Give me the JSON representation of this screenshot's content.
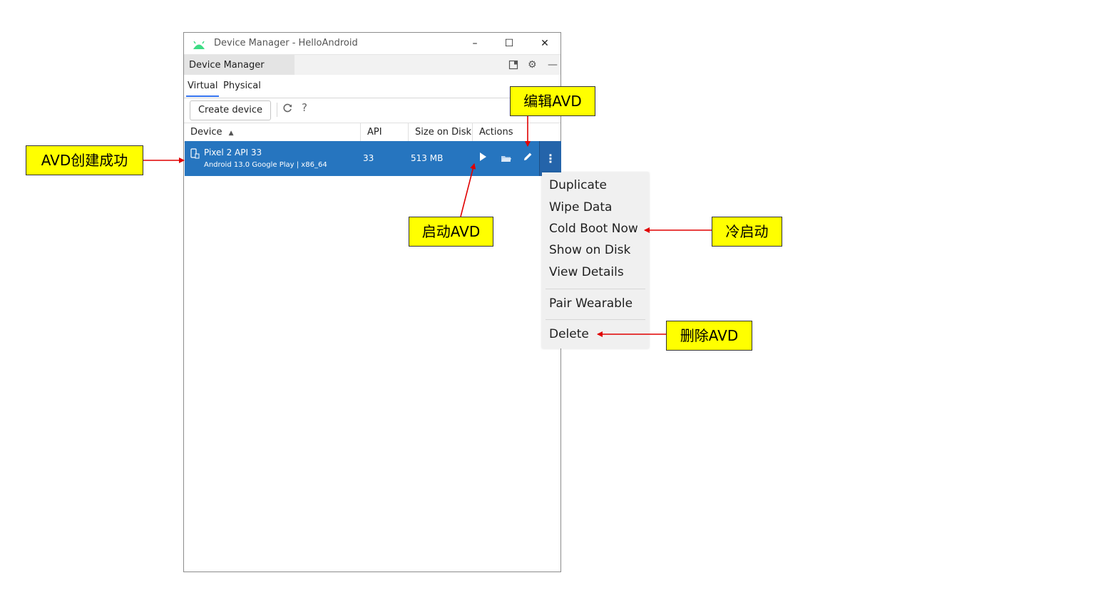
{
  "window": {
    "title": "Device Manager - HelloAndroid",
    "controls": {
      "minimize": "–",
      "maximize": "☐",
      "close": "✕"
    }
  },
  "tool_window": {
    "title": "Device Manager"
  },
  "tabs": [
    {
      "label": "Virtual",
      "active": true
    },
    {
      "label": "Physical",
      "active": false
    }
  ],
  "toolbar": {
    "create_label": "Create device",
    "help": "?"
  },
  "table": {
    "headers": {
      "device": "Device",
      "api": "API",
      "size": "Size on Disk",
      "actions": "Actions"
    },
    "sort_indicator": "▲",
    "rows": [
      {
        "name": "Pixel 2 API 33",
        "subtitle": "Android 13.0 Google Play | x86_64",
        "api": "33",
        "size": "513 MB"
      }
    ]
  },
  "context_menu": {
    "items": [
      "Duplicate",
      "Wipe Data",
      "Cold Boot Now",
      "Show on Disk",
      "View Details",
      "Pair Wearable",
      "Delete"
    ]
  },
  "annotations": {
    "created": "AVD创建成功",
    "edit": "编辑AVD",
    "launch": "启动AVD",
    "cold_boot": "冷启动",
    "delete": "删除AVD"
  },
  "colors": {
    "selection": "#2675bf",
    "callout": "#ffff00",
    "arrow": "#e00000",
    "android": "#3ddc84"
  },
  "icons": [
    "android-icon",
    "pin-icon",
    "gear-icon",
    "hide-icon",
    "refresh-icon",
    "help-icon",
    "phone-icon",
    "play-icon",
    "folder-icon",
    "pencil-icon",
    "more-vertical-icon"
  ]
}
